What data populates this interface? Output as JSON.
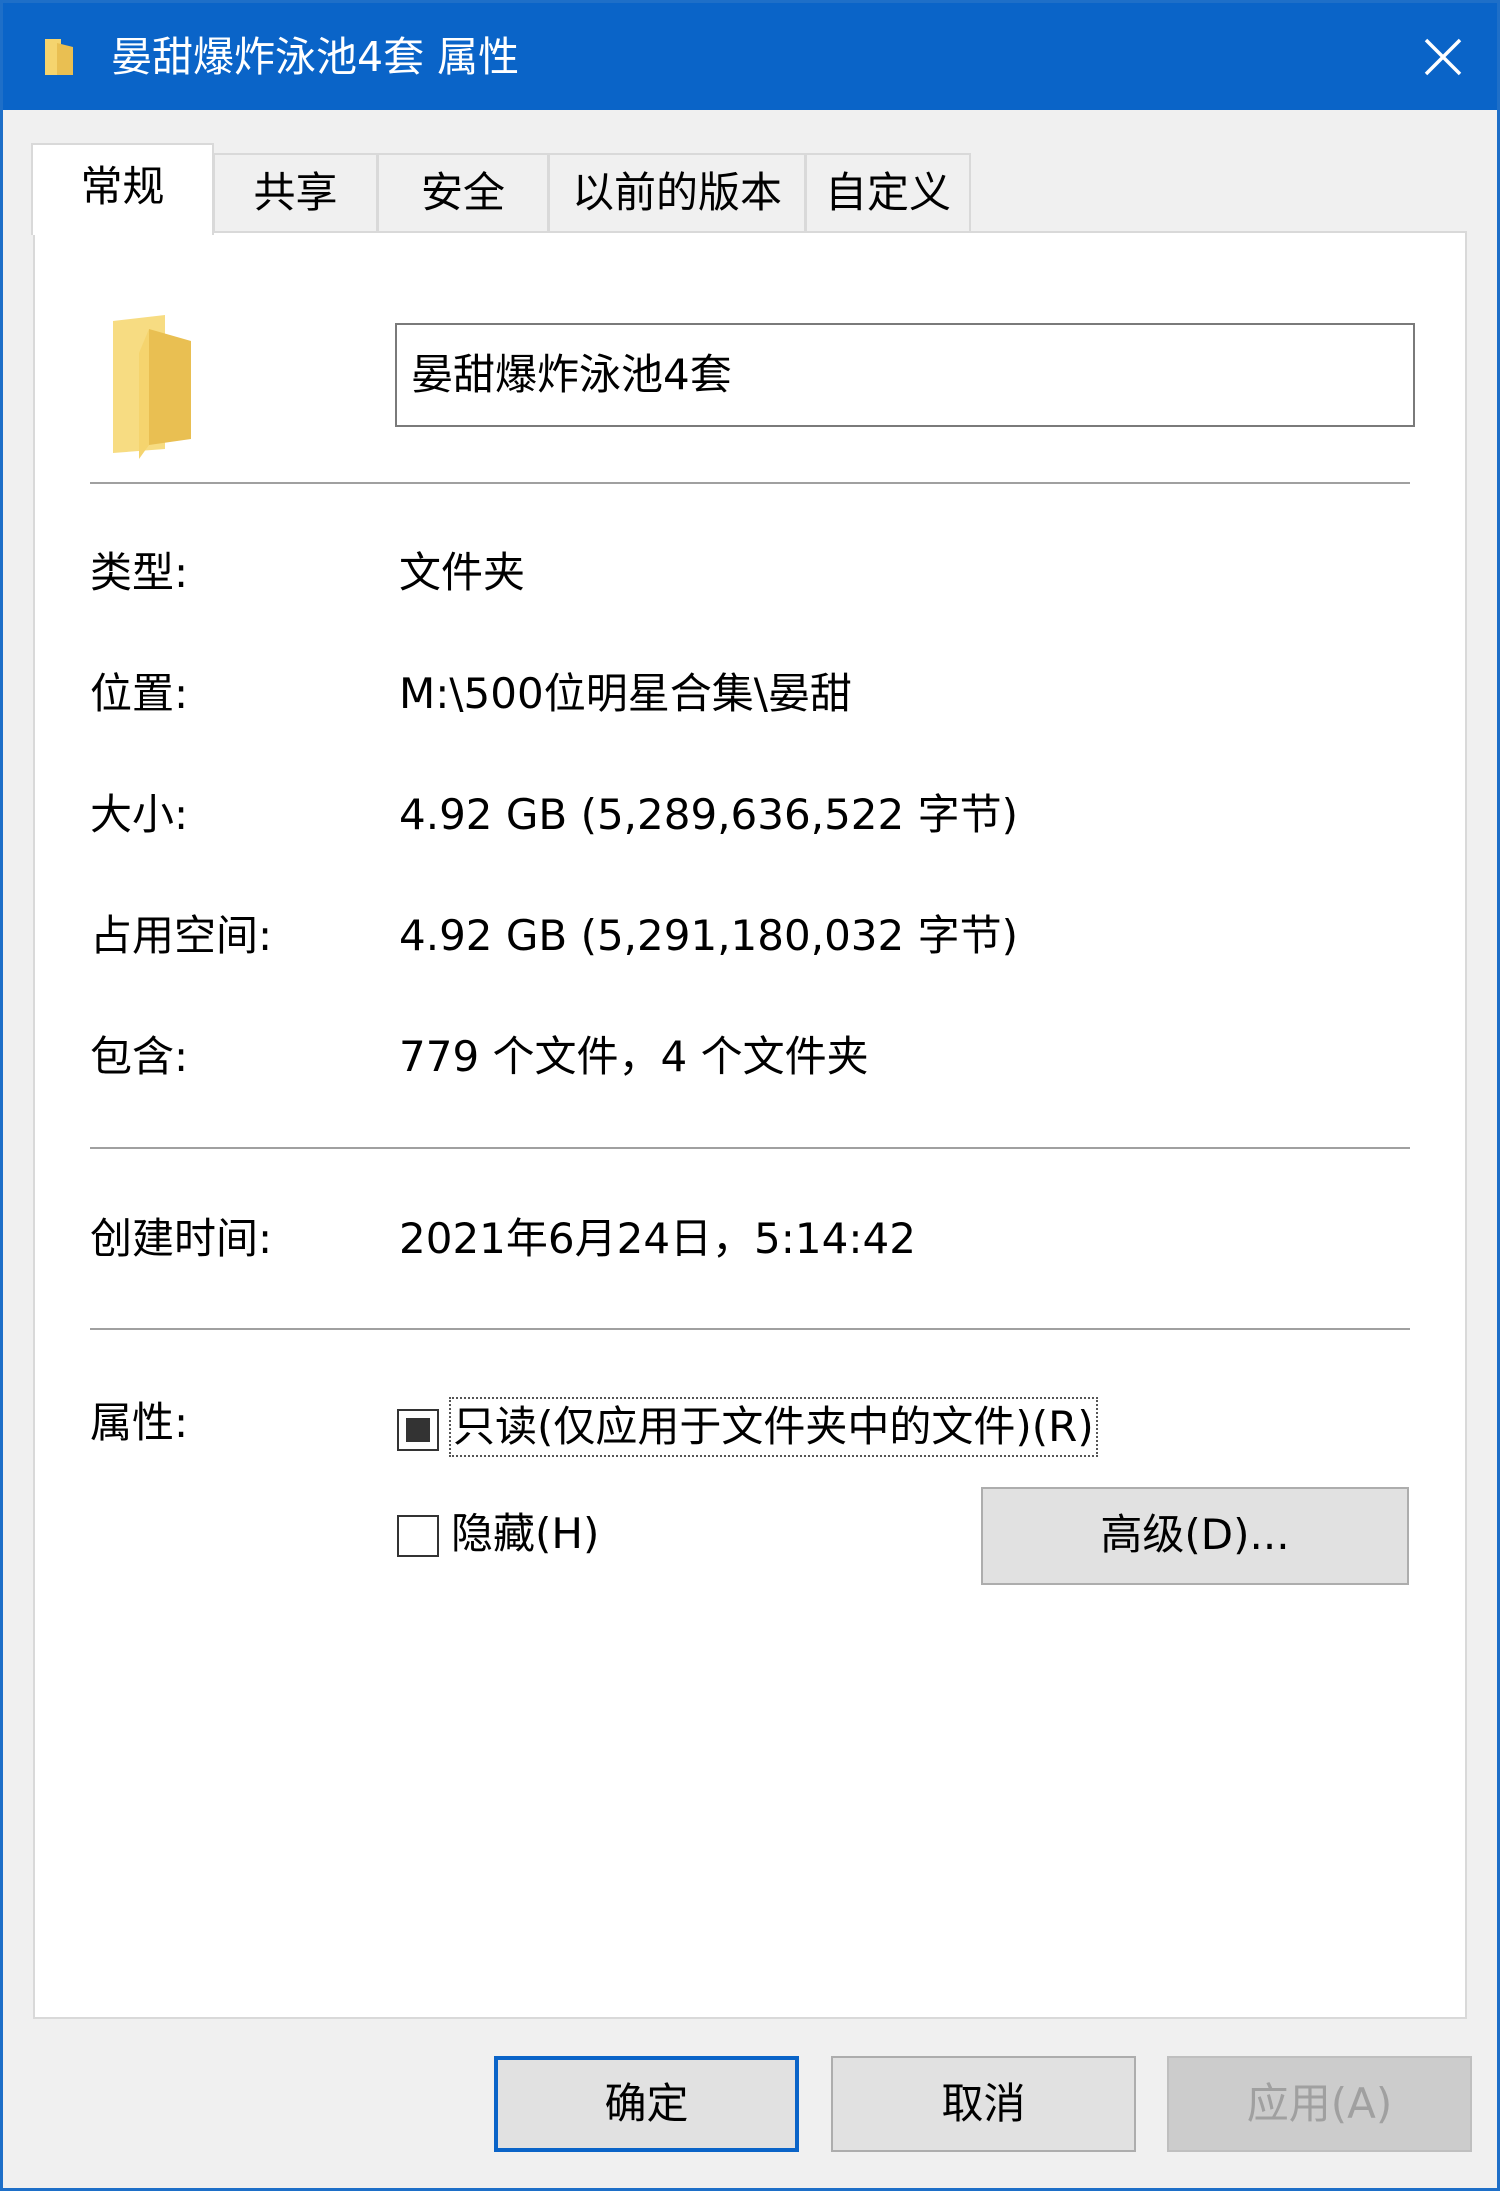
{
  "window": {
    "title": "晏甜爆炸泳池4套 属性"
  },
  "tabs": [
    {
      "label": "常规",
      "active": true
    },
    {
      "label": "共享",
      "active": false
    },
    {
      "label": "安全",
      "active": false
    },
    {
      "label": "以前的版本",
      "active": false
    },
    {
      "label": "自定义",
      "active": false
    }
  ],
  "general": {
    "name_value": "晏甜爆炸泳池4套",
    "type_label": "类型:",
    "type_value": "文件夹",
    "location_label": "位置:",
    "location_value": "M:\\500位明星合集\\晏甜",
    "size_label": "大小:",
    "size_value": "4.92 GB (5,289,636,522 字节)",
    "size_on_disk_label": "占用空间:",
    "size_on_disk_value": "4.92 GB (5,291,180,032 字节)",
    "contains_label": "包含:",
    "contains_value": "779 个文件，4 个文件夹",
    "created_label": "创建时间:",
    "created_value": "2021年6月24日，5:14:42",
    "attributes_label": "属性:",
    "readonly_label": "只读(仅应用于文件夹中的文件)(R)",
    "readonly_state": "indeterminate",
    "hidden_label": "隐藏(H)",
    "hidden_state": "unchecked",
    "advanced_label": "高级(D)..."
  },
  "footer": {
    "ok_label": "确定",
    "cancel_label": "取消",
    "apply_label": "应用(A)"
  },
  "colors": {
    "titlebar": "#0a64c8",
    "folder_yellow": "#f5d46e",
    "folder_dark": "#e6b84a"
  }
}
